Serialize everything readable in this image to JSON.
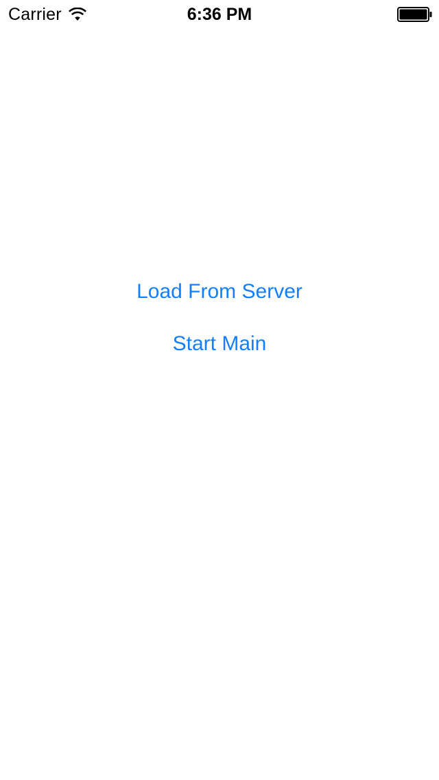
{
  "status_bar": {
    "carrier": "Carrier",
    "time": "6:36 PM",
    "wifi_icon": "wifi-icon",
    "battery_icon": "battery-full-icon",
    "battery_level": 1.0
  },
  "main": {
    "load_button_label": "Load From Server",
    "start_button_label": "Start Main"
  },
  "colors": {
    "accent": "#157efb",
    "background": "#ffffff",
    "text": "#000000"
  }
}
